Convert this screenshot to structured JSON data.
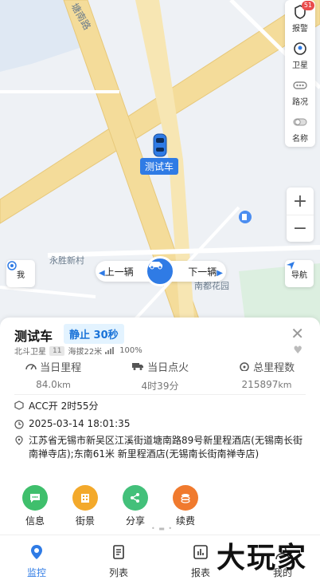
{
  "map": {
    "road_label_1": "塘南路",
    "road_label_2": "永胜新村",
    "road_label_3": "南都花园",
    "vehicle_tag": "测试车"
  },
  "right_tools": [
    {
      "label": "报警",
      "badge": "51",
      "icon": "alarm-icon"
    },
    {
      "label": "卫星",
      "icon": "satellite-icon"
    },
    {
      "label": "路况",
      "icon": "traffic-icon"
    },
    {
      "label": "名称",
      "icon": "name-toggle-icon"
    }
  ],
  "zoom": {
    "in": "+",
    "out": "−"
  },
  "me_button": {
    "label": "我"
  },
  "nav_button": {
    "label": "导航"
  },
  "switcher": {
    "prev": "上一辆",
    "next": "下一辆"
  },
  "panel": {
    "title": "测试车",
    "status": "静止 30秒",
    "positioning": "北斗卫星",
    "satellites": "11",
    "altitude": "海拔22米",
    "signal": "100%",
    "stats": [
      {
        "label": "当日里程",
        "value": "84.0",
        "unit": "km"
      },
      {
        "label": "当日点火",
        "value": "4时39分",
        "unit": ""
      },
      {
        "label": "总里程数",
        "value": "215897",
        "unit": "km"
      }
    ],
    "acc": "ACC开 2时55分",
    "time": "2025-03-14 18:01:35",
    "address": "江苏省无锡市新吴区江溪街道塘南路89号新里程酒店(无锡南长街南禅寺店);东南61米 新里程酒店(无锡南长街南禅寺店)",
    "actions": [
      {
        "label": "信息",
        "color": "#3fbf6c"
      },
      {
        "label": "街景",
        "color": "#f3a92b"
      },
      {
        "label": "分享",
        "color": "#43c07a"
      },
      {
        "label": "续费",
        "color": "#f07a2e"
      }
    ],
    "dots": "• ▬ •"
  },
  "tabs": [
    {
      "label": "监控",
      "active": true
    },
    {
      "label": "列表"
    },
    {
      "label": "报表"
    },
    {
      "label": "我的"
    }
  ],
  "watermark": "大玩家",
  "colors": {
    "accent": "#2f7be5",
    "road": "#f4dc9a"
  }
}
